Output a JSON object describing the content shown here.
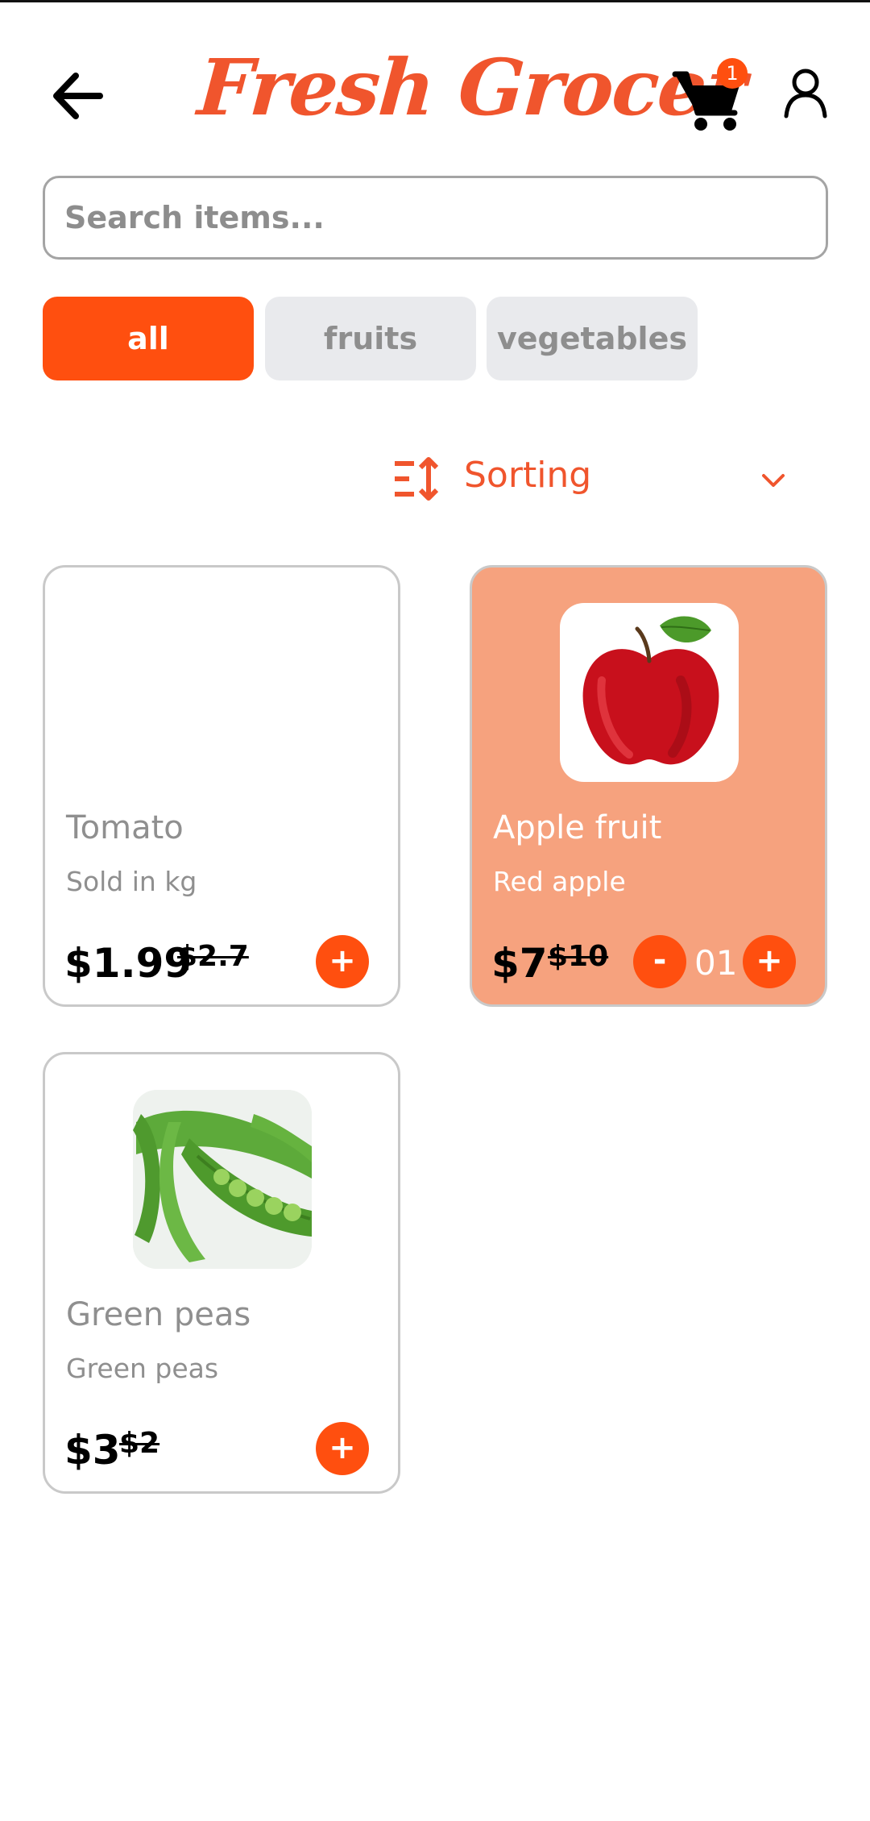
{
  "header": {
    "brand": "Fresh Grocer",
    "cart_count": "1",
    "back_icon": "arrow-left-icon",
    "cart_icon": "cart-icon",
    "user_icon": "user-icon"
  },
  "search": {
    "placeholder": "Search items..."
  },
  "filters": [
    {
      "label": "all",
      "active": true
    },
    {
      "label": "fruits",
      "active": false
    },
    {
      "label": "vegetables",
      "active": false
    }
  ],
  "sorting": {
    "label": "Sorting",
    "icon": "sort-icon",
    "chevron": "chevron-down-icon"
  },
  "products": [
    {
      "name": "Tomato",
      "subtitle": "Sold in kg",
      "price": "$1.99",
      "old_price": "$2.7",
      "add": "+"
    },
    {
      "name": "Apple fruit",
      "subtitle": "Red apple",
      "price": "$7",
      "old_price": "$10",
      "minus": "-",
      "quantity": "01",
      "add": "+"
    },
    {
      "name": "Green peas",
      "subtitle": "Green peas",
      "price": "$3",
      "old_price": "$2",
      "add": "+"
    }
  ],
  "colors": {
    "accent": "#ff4f0f",
    "brand": "#f0552d",
    "highlight_card": "#f6a27e",
    "chip_inactive": "#e9eaed"
  }
}
